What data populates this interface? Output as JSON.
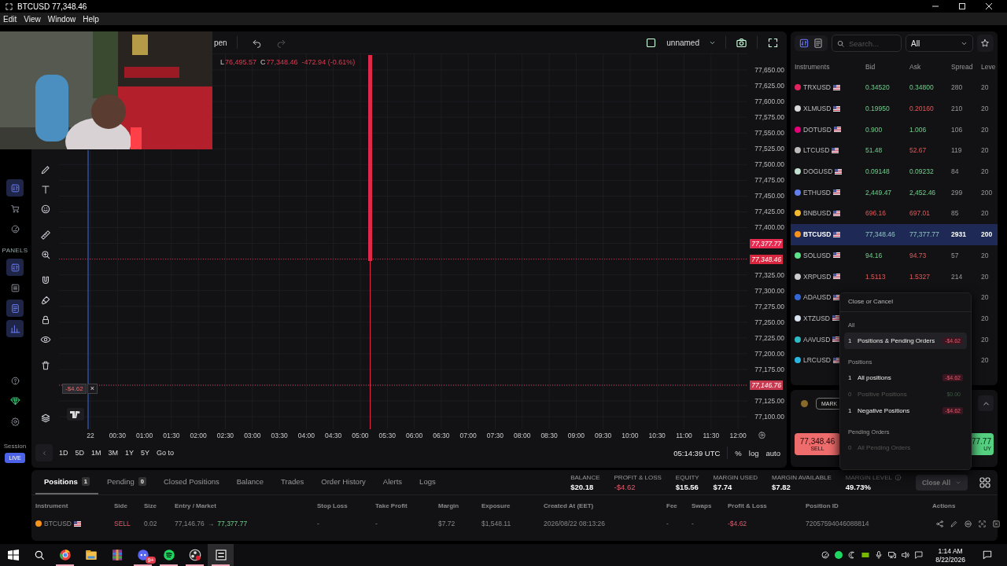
{
  "window": {
    "title": "BTCUSD 77,348.46"
  },
  "menu": [
    "Edit",
    "View",
    "Window",
    "Help"
  ],
  "app_sidebar": {
    "items": [
      {
        "selected": true
      },
      {
        "selected": false
      },
      {
        "selected": false
      }
    ],
    "section": "PANELS",
    "panel_items": [
      {
        "selected": true
      },
      {
        "selected": false
      },
      {
        "selected": true
      },
      {
        "selected": true
      }
    ],
    "session": "Session",
    "mode": "LIVE"
  },
  "chart": {
    "toolbar_label": "pen",
    "layout_name": "unnamed",
    "legend": [
      {
        "label": "L",
        "value": "76,495.57"
      },
      {
        "label": "C",
        "value": "77,348.46"
      }
    ],
    "change": "-472.94 (-0.61%)",
    "price_scale": [
      {
        "kind": "tick",
        "text": "77,650.00"
      },
      {
        "kind": "tick",
        "text": "77,625.00"
      },
      {
        "kind": "tick",
        "text": "77,600.00"
      },
      {
        "kind": "tick",
        "text": "77,575.00"
      },
      {
        "kind": "tick",
        "text": "77,550.00"
      },
      {
        "kind": "tick",
        "text": "77,525.00"
      },
      {
        "kind": "tick",
        "text": "77,500.00"
      },
      {
        "kind": "tick",
        "text": "77,475.00"
      },
      {
        "kind": "tick",
        "text": "77,450.00"
      },
      {
        "kind": "tick",
        "text": "77,425.00"
      },
      {
        "kind": "tick",
        "text": "77,400.00"
      },
      {
        "kind": "ask",
        "text": "77,377.77"
      },
      {
        "kind": "bid",
        "text": "77,348.46"
      },
      {
        "kind": "tick",
        "text": "77,325.00"
      },
      {
        "kind": "tick",
        "text": "77,300.00"
      },
      {
        "kind": "tick",
        "text": "77,275.00"
      },
      {
        "kind": "tick",
        "text": "77,250.00"
      },
      {
        "kind": "tick",
        "text": "77,225.00"
      },
      {
        "kind": "tick",
        "text": "77,200.00"
      },
      {
        "kind": "tick",
        "text": "77,175.00"
      },
      {
        "kind": "entry",
        "text": "77,146.76"
      },
      {
        "kind": "tick",
        "text": "77,125.00"
      },
      {
        "kind": "tick",
        "text": "77,100.00"
      }
    ],
    "position_line": {
      "pnl": "-$4.62",
      "close": "×"
    },
    "time_labels": [
      "22",
      "00:30",
      "01:00",
      "01:30",
      "02:00",
      "02:30",
      "03:00",
      "03:30",
      "04:00",
      "04:30",
      "05:00",
      "05:30",
      "06:00",
      "06:30",
      "07:00",
      "07:30",
      "08:00",
      "08:30",
      "09:00",
      "09:30",
      "10:00",
      "10:30",
      "11:00",
      "11:30",
      "12:00"
    ],
    "ranges": [
      "1D",
      "5D",
      "1M",
      "3M",
      "1Y",
      "5Y"
    ],
    "goto": "Go to",
    "clock": "05:14:39 UTC",
    "scale_options": [
      "%",
      "log",
      "auto"
    ]
  },
  "market": {
    "search_placeholder": "Search...",
    "filter": "All",
    "columns": [
      "Instruments",
      "Bid",
      "Ask",
      "Spread",
      "Leve"
    ],
    "rows": [
      {
        "symbol": "TRXUSD",
        "color": "#e0245e",
        "bid": "0.34520",
        "bid_rising": true,
        "ask": "0.34800",
        "ask_rising": true,
        "spread": "280",
        "leverage": "20",
        "selected": false
      },
      {
        "symbol": "XLMUSD",
        "color": "#d8d8d8",
        "bid": "0.19950",
        "bid_rising": true,
        "ask": "0.20160",
        "ask_rising": false,
        "spread": "210",
        "leverage": "20",
        "selected": false
      },
      {
        "symbol": "DOTUSD",
        "color": "#e6007a",
        "bid": "0.900",
        "bid_rising": true,
        "ask": "1.006",
        "ask_rising": true,
        "spread": "106",
        "leverage": "20",
        "selected": false
      },
      {
        "symbol": "LTCUSD",
        "color": "#bfbbbb",
        "bid": "51.48",
        "bid_rising": true,
        "ask": "52.67",
        "ask_rising": false,
        "spread": "119",
        "leverage": "20",
        "selected": false
      },
      {
        "symbol": "DOGUSD",
        "color": "#c2e0d0",
        "bid": "0.09148",
        "bid_rising": true,
        "ask": "0.09232",
        "ask_rising": true,
        "spread": "84",
        "leverage": "20",
        "selected": false
      },
      {
        "symbol": "ETHUSD",
        "color": "#627eea",
        "bid": "2,449.47",
        "bid_rising": true,
        "ask": "2,452.46",
        "ask_rising": true,
        "spread": "299",
        "leverage": "200",
        "selected": false
      },
      {
        "symbol": "BNBUSD",
        "color": "#f3ba2f",
        "bid": "696.16",
        "bid_rising": false,
        "ask": "697.01",
        "ask_rising": false,
        "spread": "85",
        "leverage": "20",
        "selected": false
      },
      {
        "symbol": "BTCUSD",
        "color": "#f7931a",
        "bid": "77,348.46",
        "bid_rising": true,
        "ask": "77,377.77",
        "ask_rising": true,
        "spread": "2931",
        "leverage": "200",
        "selected": true
      },
      {
        "symbol": "SOLUSD",
        "color": "#5ee38a",
        "bid": "94.16",
        "bid_rising": true,
        "ask": "94.73",
        "ask_rising": false,
        "spread": "57",
        "leverage": "20",
        "selected": false
      },
      {
        "symbol": "XRPUSD",
        "color": "#cccccc",
        "bid": "1.5113",
        "bid_rising": false,
        "ask": "1.5327",
        "ask_rising": false,
        "spread": "214",
        "leverage": "20",
        "selected": false
      },
      {
        "symbol": "ADAUSD",
        "color": "#3467d6",
        "leverage": "20",
        "selected": false
      },
      {
        "symbol": "XTZUSD",
        "color": "#d8e4f0",
        "leverage": "20",
        "selected": false
      },
      {
        "symbol": "AAVUSD",
        "color": "#2ebac6",
        "leverage": "20",
        "selected": false
      },
      {
        "symbol": "LRCUSD",
        "color": "#2ab6e0",
        "leverage": "20",
        "selected": false
      }
    ]
  },
  "trade": {
    "order_type": "MARK",
    "sell": {
      "price": "77,348.46",
      "label": "SELL"
    },
    "buy": {
      "price": "77.77",
      "label": "UY"
    }
  },
  "close_menu": {
    "title": "Close or Cancel",
    "sections": [
      {
        "heading": "All",
        "items": [
          {
            "count": "1",
            "label": "Positions & Pending Orders",
            "amount": "-$4.62",
            "kind": "loss",
            "disabled": false,
            "selected": true
          }
        ]
      },
      {
        "heading": "Positions",
        "items": [
          {
            "count": "1",
            "label": "All positions",
            "amount": "-$4.62",
            "kind": "loss",
            "disabled": false,
            "selected": false
          },
          {
            "count": "0",
            "label": "Positive Positions",
            "amount": "$0.00",
            "kind": "zero",
            "disabled": true,
            "selected": false
          },
          {
            "count": "1",
            "label": "Negative Positions",
            "amount": "-$4.62",
            "kind": "loss",
            "disabled": false,
            "selected": false
          }
        ]
      },
      {
        "heading": "Pending Orders",
        "items": [
          {
            "count": "0",
            "label": "All Pending Orders",
            "disabled": true,
            "selected": false
          }
        ]
      }
    ]
  },
  "account": {
    "tabs": [
      {
        "label": "Positions",
        "count": "1",
        "selected": true
      },
      {
        "label": "Pending",
        "count": "0",
        "selected": false
      },
      {
        "label": "Closed Positions",
        "selected": false
      },
      {
        "label": "Balance",
        "selected": false
      },
      {
        "label": "Trades",
        "selected": false
      },
      {
        "label": "Order History",
        "selected": false
      },
      {
        "label": "Alerts",
        "selected": false
      },
      {
        "label": "Logs",
        "selected": false
      }
    ],
    "stats": [
      {
        "label": "BALANCE",
        "value": "$20.18",
        "kind": "plain"
      },
      {
        "label": "PROFIT & LOSS",
        "value": "-$4.62",
        "kind": "loss"
      },
      {
        "label": "EQUITY",
        "value": "$15.56",
        "kind": "plain"
      },
      {
        "label": "MARGIN USED",
        "value": "$7.74",
        "kind": "plain"
      },
      {
        "label": "MARGIN AVAILABLE",
        "value": "$7.82",
        "kind": "plain"
      },
      {
        "label": "MARGIN LEVEL",
        "value": "49.73%",
        "kind": "info"
      }
    ],
    "close_all": "Close All",
    "columns": [
      "Instrument",
      "Side",
      "Size",
      "Entry / Market",
      "Stop Loss",
      "Take Profit",
      "Margin",
      "Exposure",
      "Created At (EET)",
      "Fee",
      "Swaps",
      "Profit & Loss",
      "Position ID",
      "Actions"
    ],
    "rows": [
      {
        "instrument": "BTCUSD",
        "color": "#f7931a",
        "side": "SELL",
        "size": "0.02",
        "entry": "77,146.76",
        "arrow": "→",
        "market": "77,377.77",
        "stop_loss": "-",
        "take_profit": "-",
        "margin": "$7.72",
        "exposure": "$1,548.11",
        "created": "2026/08/22 08:13:26",
        "fee": "-",
        "swaps": "-",
        "pnl": "-$4.62",
        "position_id": "72057594046088814"
      }
    ]
  },
  "taskbar": {
    "apps": [
      {
        "open": true,
        "selected": false
      },
      {
        "open": false,
        "selected": false
      },
      {
        "open": false,
        "selected": false
      },
      {
        "open": true,
        "selected": false,
        "badge": "9+"
      },
      {
        "open": true,
        "selected": false
      },
      {
        "open": true,
        "selected": false
      },
      {
        "open": true,
        "selected": true
      }
    ],
    "time": "1:14 AM",
    "date": "8/22/2026"
  }
}
